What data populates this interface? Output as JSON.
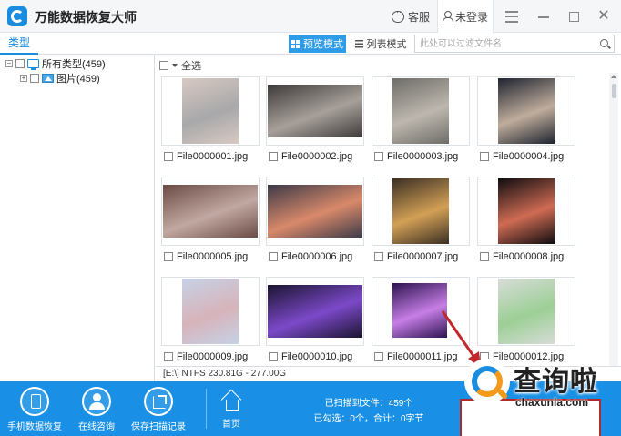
{
  "app": {
    "title": "万能数据恢复大师"
  },
  "titlebar": {
    "service_label": "客服",
    "user_label": "未登录",
    "close_glyph": "✕"
  },
  "toolbar": {
    "tab_type": "类型",
    "preview_mode": "预览模式",
    "list_mode": "列表模式",
    "search_placeholder": "此处可以过滤文件名"
  },
  "tree": {
    "all_types": "所有类型(459)",
    "pictures": "图片(459)",
    "collapse_glyph": "−",
    "expand_glyph": "+"
  },
  "content": {
    "select_all": "全选",
    "files": [
      {
        "name": "File0000001.jpg",
        "colors": [
          "#d8c9c2",
          "#a8a8aa"
        ]
      },
      {
        "name": "File0000002.jpg",
        "colors": [
          "#3e3a3a",
          "#a7a09a"
        ]
      },
      {
        "name": "File0000003.jpg",
        "colors": [
          "#6e6d68",
          "#bdb7ae"
        ]
      },
      {
        "name": "File0000004.jpg",
        "colors": [
          "#1e2430",
          "#c0ad9c"
        ]
      },
      {
        "name": "File0000005.jpg",
        "colors": [
          "#6b4c45",
          "#c2a8a2"
        ]
      },
      {
        "name": "File0000006.jpg",
        "colors": [
          "#3c3a48",
          "#d9896a"
        ]
      },
      {
        "name": "File0000007.jpg",
        "colors": [
          "#3a2f24",
          "#d3a055"
        ]
      },
      {
        "name": "File0000008.jpg",
        "colors": [
          "#0f0d10",
          "#cf6b53"
        ]
      },
      {
        "name": "File0000009.jpg",
        "colors": [
          "#c6d2e6",
          "#d7b3ba"
        ]
      },
      {
        "name": "File0000010.jpg",
        "colors": [
          "#1a1430",
          "#7c49c9"
        ]
      },
      {
        "name": "File0000011.jpg",
        "colors": [
          "#2c1450",
          "#c77ee6"
        ]
      },
      {
        "name": "File0000012.jpg",
        "colors": [
          "#d8dcd8",
          "#9ccf95"
        ]
      }
    ]
  },
  "status": {
    "partition": "[E:\\] NTFS 230.81G - 277.00G"
  },
  "bottom": {
    "phone_recovery": "手机数据恢复",
    "online_consult": "在线咨询",
    "save_scan": "保存扫描记录",
    "home": "首页",
    "scanned_files": "已扫描到文件：459个",
    "selected_info": "已勾选：0个，合计：0字节"
  },
  "watermark": {
    "text": "查询啦",
    "url": "chaxunla.com"
  },
  "colors": {
    "accent": "#1990e5",
    "highlight_border": "#b22a2a",
    "watermark_orange": "#f39a1a"
  }
}
